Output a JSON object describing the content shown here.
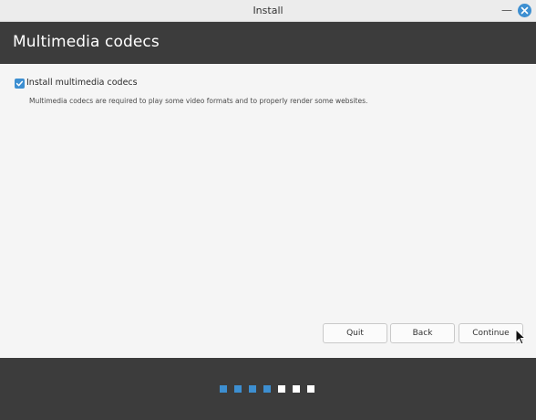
{
  "window": {
    "title": "Install",
    "minimize_glyph": "—",
    "close_icon": "close-icon",
    "accent_color": "#3d8fd1"
  },
  "header": {
    "title": "Multimedia codecs",
    "background": "#3c3c3c"
  },
  "codecs": {
    "checkbox_label": "Install multimedia codecs",
    "checked": true,
    "description": "Multimedia codecs are required to play some video formats and to properly render some websites."
  },
  "buttons": {
    "quit": "Quit",
    "back": "Back",
    "continue": "Continue"
  },
  "progress": {
    "total_steps": 7,
    "completed_steps": 4,
    "completed_color": "#3d8fd1",
    "remaining_color": "#ffffff"
  }
}
